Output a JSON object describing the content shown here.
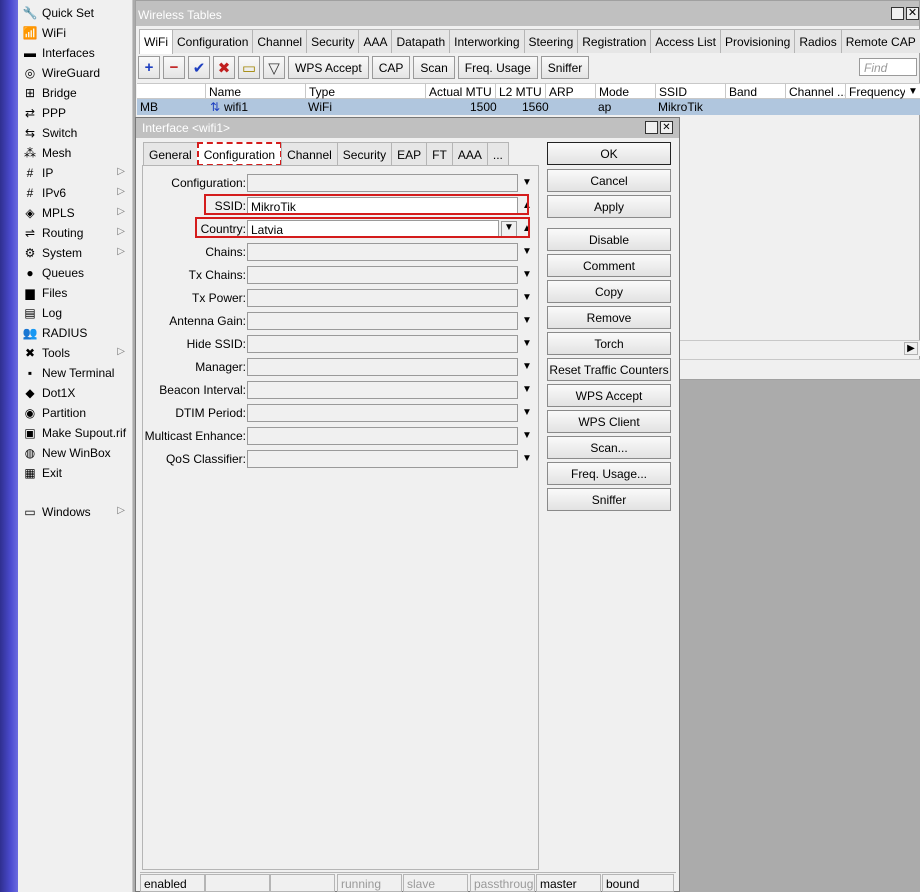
{
  "sidebar": {
    "items": [
      {
        "label": "Quick Set",
        "icon": "quickset-icon",
        "glyph": "🔧",
        "submenu": false
      },
      {
        "label": "WiFi",
        "icon": "wifi-icon",
        "glyph": "📶",
        "submenu": false
      },
      {
        "label": "Interfaces",
        "icon": "interfaces-icon",
        "glyph": "▬",
        "submenu": false
      },
      {
        "label": "WireGuard",
        "icon": "wireguard-icon",
        "glyph": "◎",
        "submenu": false
      },
      {
        "label": "Bridge",
        "icon": "bridge-icon",
        "glyph": "⊞",
        "submenu": false
      },
      {
        "label": "PPP",
        "icon": "ppp-icon",
        "glyph": "⇄",
        "submenu": false
      },
      {
        "label": "Switch",
        "icon": "switch-icon",
        "glyph": "⇆",
        "submenu": false
      },
      {
        "label": "Mesh",
        "icon": "mesh-icon",
        "glyph": "⁂",
        "submenu": false
      },
      {
        "label": "IP",
        "icon": "ip-icon",
        "glyph": "#",
        "submenu": true
      },
      {
        "label": "IPv6",
        "icon": "ipv6-icon",
        "glyph": "#",
        "submenu": true
      },
      {
        "label": "MPLS",
        "icon": "mpls-icon",
        "glyph": "◈",
        "submenu": true
      },
      {
        "label": "Routing",
        "icon": "routing-icon",
        "glyph": "⇌",
        "submenu": true
      },
      {
        "label": "System",
        "icon": "system-icon",
        "glyph": "⚙",
        "submenu": true
      },
      {
        "label": "Queues",
        "icon": "queues-icon",
        "glyph": "●",
        "submenu": false
      },
      {
        "label": "Files",
        "icon": "files-icon",
        "glyph": "▆",
        "submenu": false
      },
      {
        "label": "Log",
        "icon": "log-icon",
        "glyph": "▤",
        "submenu": false
      },
      {
        "label": "RADIUS",
        "icon": "radius-icon",
        "glyph": "👥",
        "submenu": false
      },
      {
        "label": "Tools",
        "icon": "tools-icon",
        "glyph": "✖",
        "submenu": true
      },
      {
        "label": "New Terminal",
        "icon": "terminal-icon",
        "glyph": "▪",
        "submenu": false
      },
      {
        "label": "Dot1X",
        "icon": "dot1x-icon",
        "glyph": "◆",
        "submenu": false
      },
      {
        "label": "Partition",
        "icon": "partition-icon",
        "glyph": "◉",
        "submenu": false
      },
      {
        "label": "Make Supout.rif",
        "icon": "supout-icon",
        "glyph": "▣",
        "submenu": false
      },
      {
        "label": "New WinBox",
        "icon": "winbox-icon",
        "glyph": "◍",
        "submenu": false
      },
      {
        "label": "Exit",
        "icon": "exit-icon",
        "glyph": "▦",
        "submenu": false
      },
      {
        "label": "Windows",
        "icon": "windows-icon",
        "glyph": "▭",
        "submenu": true
      }
    ]
  },
  "wireless": {
    "title": "Wireless Tables",
    "tabs": [
      "WiFi",
      "Configuration",
      "Channel",
      "Security",
      "AAA",
      "Datapath",
      "Interworking",
      "Steering",
      "Registration",
      "Access List",
      "Provisioning",
      "Radios",
      "Remote CAP"
    ],
    "toolbar": {
      "add": "+",
      "remove": "−",
      "enable": "✔",
      "disable": "✖",
      "comment": "▭",
      "filter": "▽",
      "wps_accept": "WPS Accept",
      "cap": "CAP",
      "scan": "Scan",
      "freq_usage": "Freq. Usage",
      "sniffer": "Sniffer"
    },
    "find_placeholder": "Find",
    "columns": [
      "Name",
      "Type",
      "Actual MTU",
      "L2 MTU",
      "ARP",
      "Mode",
      "SSID",
      "Band",
      "Channel ...",
      "Frequency"
    ],
    "row": {
      "flag": "MB",
      "name": "wifi1",
      "type": "WiFi",
      "actual_mtu": "1500",
      "l2_mtu": "1560",
      "arp": "",
      "mode": "ap",
      "ssid": "MikroTik",
      "band": "",
      "channel": "",
      "frequency": ""
    }
  },
  "dialog": {
    "title": "Interface <wifi1>",
    "tabs": [
      "General",
      "Configuration",
      "Channel",
      "Security",
      "EAP",
      "FT",
      "AAA",
      "..."
    ],
    "fields": [
      {
        "label": "Configuration:",
        "value": "",
        "kind": "drop"
      },
      {
        "label": "SSID:",
        "value": "MikroTik",
        "kind": "up"
      },
      {
        "label": "Country:",
        "value": "Latvia",
        "kind": "dropup"
      },
      {
        "label": "Chains:",
        "value": "",
        "kind": "drop"
      },
      {
        "label": "Tx Chains:",
        "value": "",
        "kind": "drop"
      },
      {
        "label": "Tx Power:",
        "value": "",
        "kind": "drop"
      },
      {
        "label": "Antenna Gain:",
        "value": "",
        "kind": "drop"
      },
      {
        "label": "Hide SSID:",
        "value": "",
        "kind": "drop"
      },
      {
        "label": "Manager:",
        "value": "",
        "kind": "drop"
      },
      {
        "label": "Beacon Interval:",
        "value": "",
        "kind": "drop"
      },
      {
        "label": "DTIM Period:",
        "value": "",
        "kind": "drop"
      },
      {
        "label": "Multicast Enhance:",
        "value": "",
        "kind": "drop"
      },
      {
        "label": "QoS Classifier:",
        "value": "",
        "kind": "drop"
      }
    ],
    "buttons": [
      "OK",
      "Cancel",
      "Apply",
      "Disable",
      "Comment",
      "Copy",
      "Remove",
      "Torch",
      "Reset Traffic Counters",
      "WPS Accept",
      "WPS Client",
      "Scan...",
      "Freq. Usage...",
      "Sniffer"
    ],
    "status": [
      "enabled",
      "",
      "",
      "running",
      "slave",
      "passthrough",
      "master",
      "bound"
    ]
  }
}
